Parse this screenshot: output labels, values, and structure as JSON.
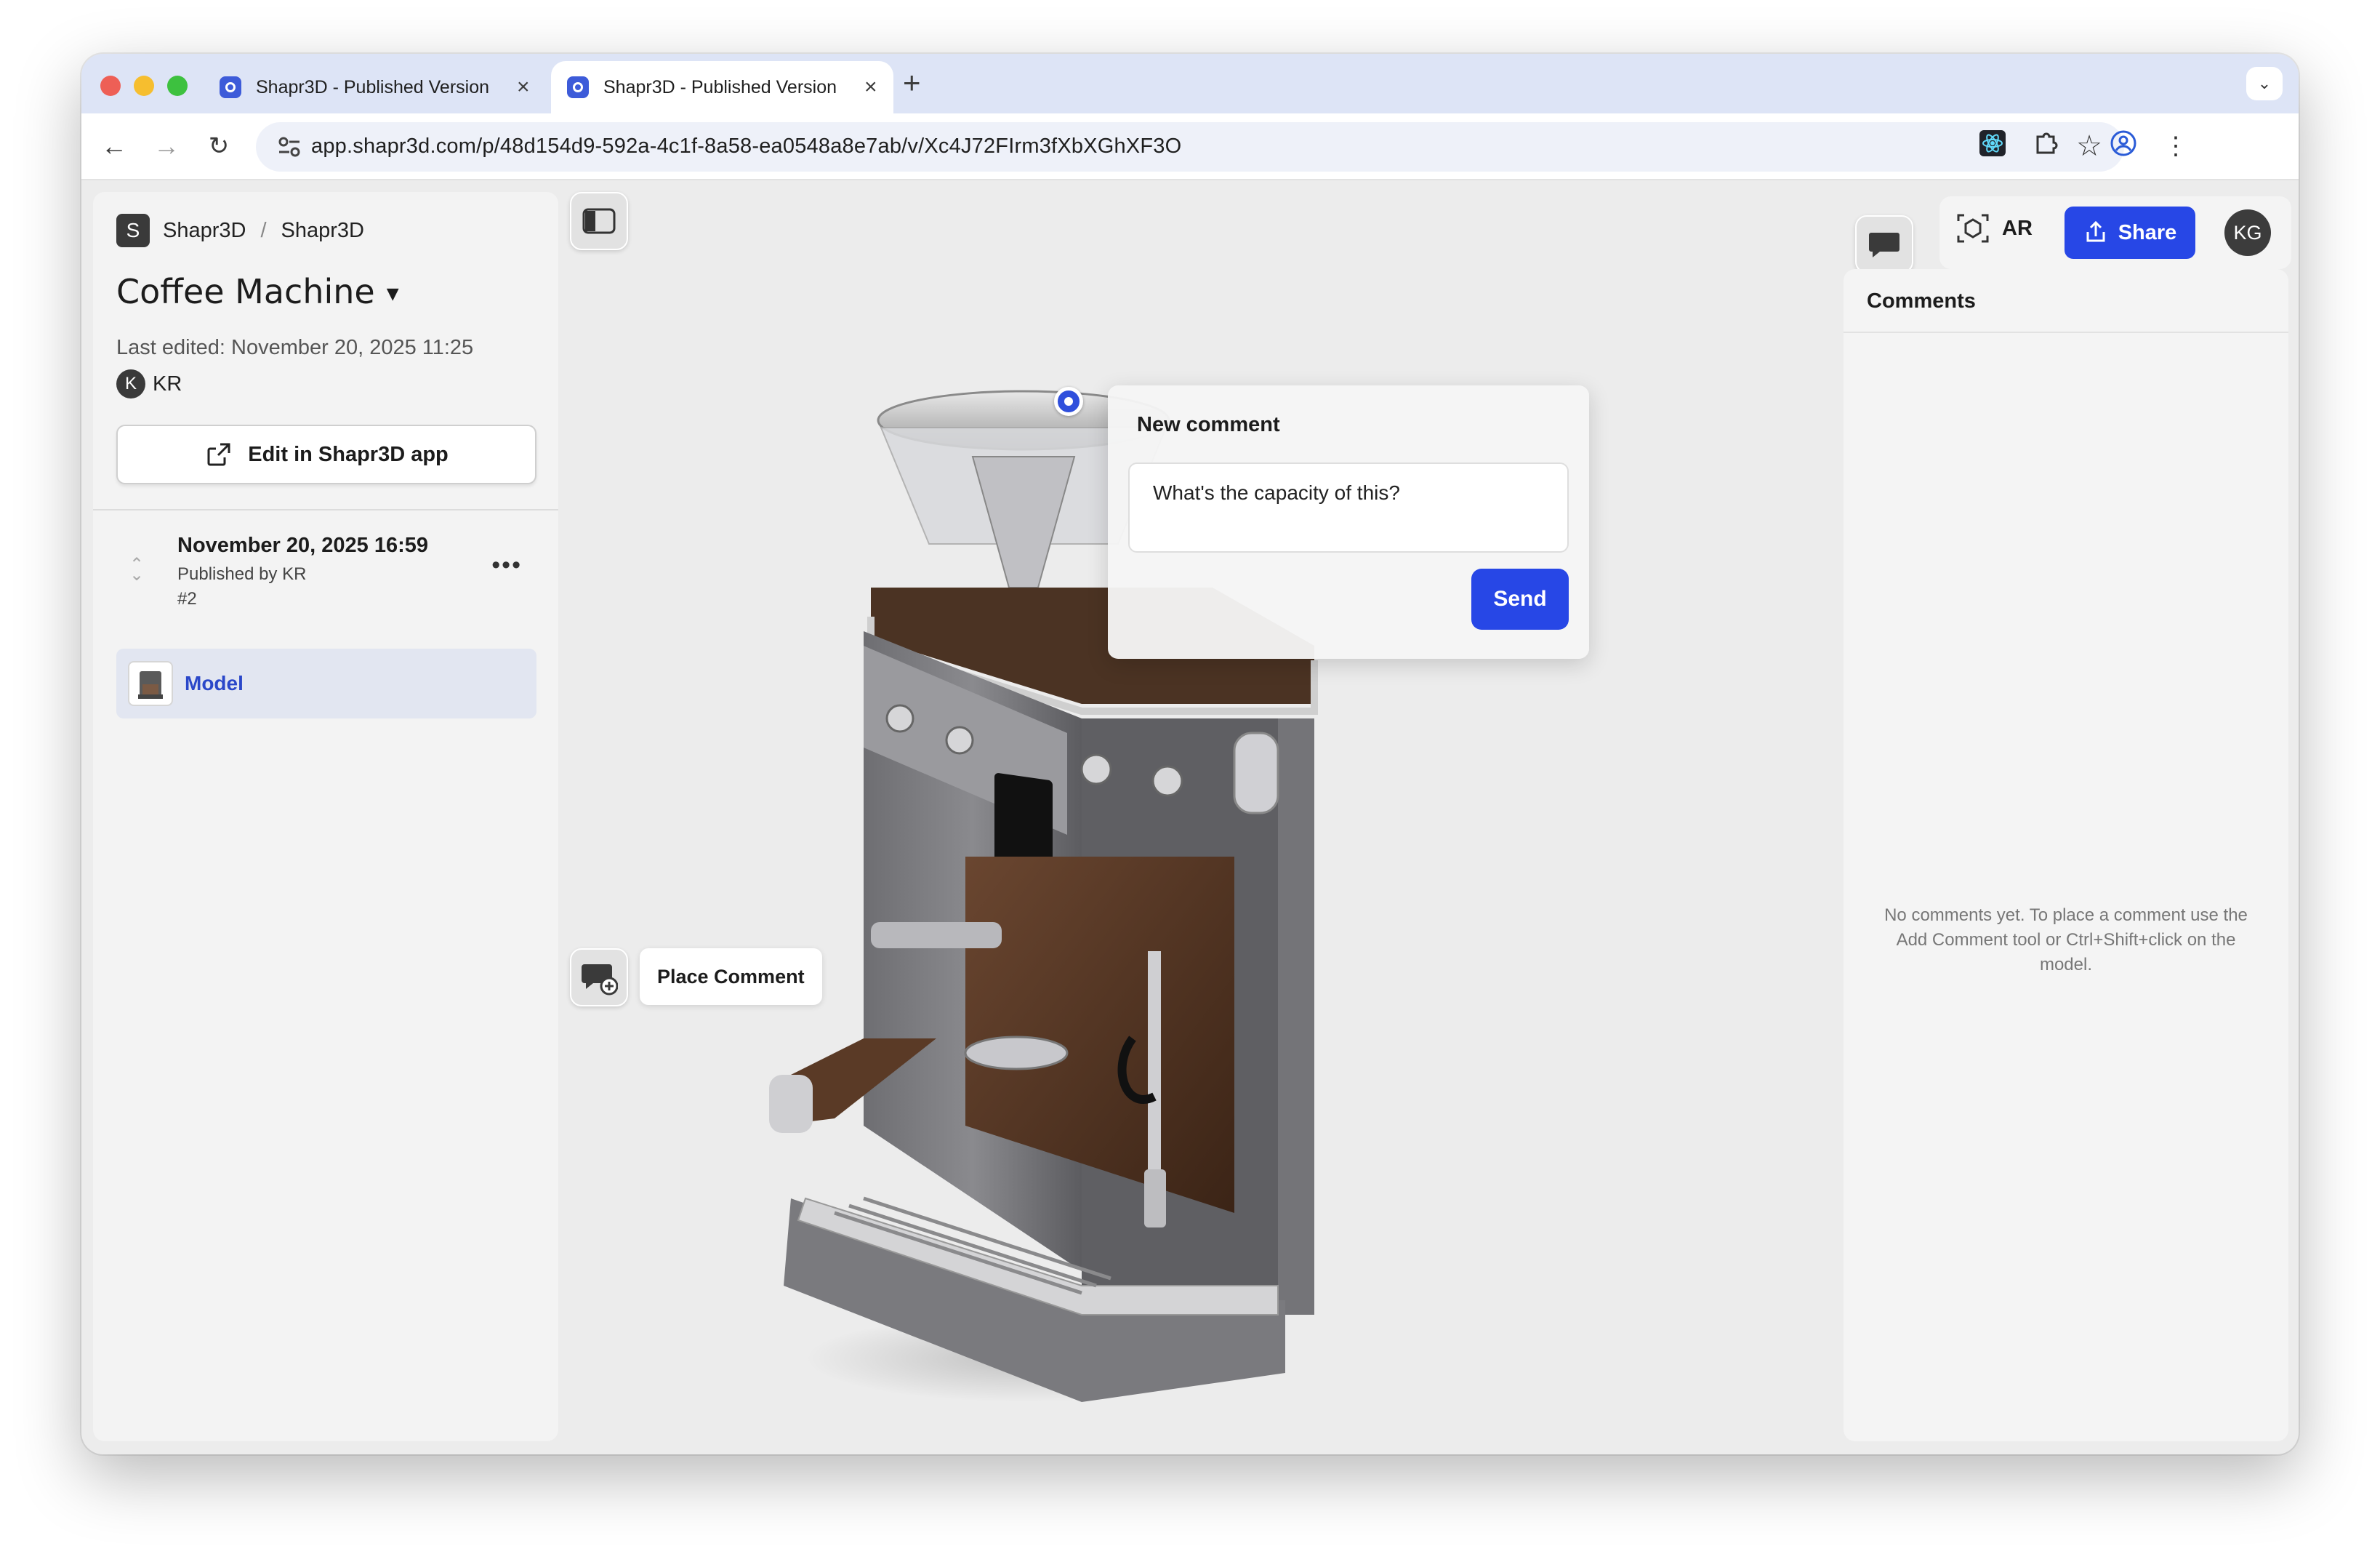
{
  "browser": {
    "tabs": [
      {
        "title": "Shapr3D - Published Version",
        "active": false
      },
      {
        "title": "Shapr3D - Published Version",
        "active": true
      }
    ],
    "url": "app.shapr3d.com/p/48d154d9-592a-4c1f-8a58-ea0548a8e7ab/v/Xc4J72FIrm3fXbXGhXF3O"
  },
  "sidebar": {
    "breadcrumb": {
      "workspace_initial": "S",
      "workspace": "Shapr3D",
      "separator": "/",
      "project": "Shapr3D"
    },
    "title": "Coffee Machine",
    "last_edited": "Last edited: November 20, 2025 11:25",
    "author": {
      "initial": "K",
      "name": "KR"
    },
    "edit_button": "Edit in Shapr3D app",
    "version": {
      "date": "November 20, 2025 16:59",
      "published_by": "Published by KR",
      "number": "#2"
    },
    "items": [
      {
        "label": "Model"
      }
    ]
  },
  "viewport": {
    "place_comment": "Place Comment",
    "new_comment": {
      "title": "New comment",
      "text": "What's the capacity of this?",
      "send": "Send"
    }
  },
  "topbar": {
    "ar": "AR",
    "share": "Share",
    "avatar": "KG"
  },
  "comments": {
    "title": "Comments",
    "empty": "No comments yet. To place a comment use the Add Comment tool or Ctrl+Shift+click on the model."
  },
  "colors": {
    "accent": "#2747e6",
    "selected_bg": "#e2e6f1",
    "link": "#2a47c9"
  }
}
